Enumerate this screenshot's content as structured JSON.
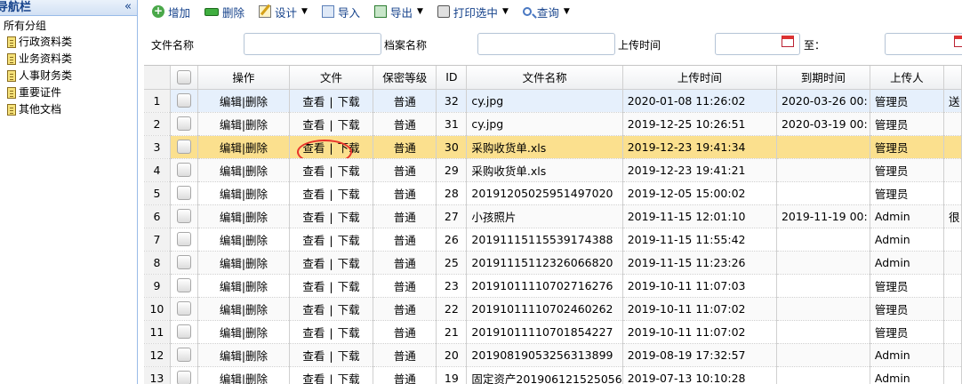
{
  "nav": {
    "title": "导航栏",
    "collapse_glyph": "«",
    "root": "所有分组",
    "items": [
      "行政资料类",
      "业务资料类",
      "人事财务类",
      "重要证件",
      "其他文档"
    ]
  },
  "toolbar": {
    "add": "增加",
    "delete": "删除",
    "design": "设计",
    "import": "导入",
    "export": "导出",
    "print": "打印选中",
    "query": "查询"
  },
  "search": {
    "file_name_label": "文件名称",
    "archive_name_label": "档案名称",
    "upload_time_label": "上传时间",
    "to_label": "至："
  },
  "grid": {
    "headers": {
      "op": "操作",
      "file": "文件",
      "security": "保密等级",
      "id": "ID",
      "name": "文件名称",
      "upload_time": "上传时间",
      "expire_time": "到期时间",
      "uploader": "上传人"
    },
    "op_edit": "编辑",
    "op_sep": "|",
    "op_delete": "删除",
    "file_view": "查看",
    "file_sep": "|",
    "file_download": "下载",
    "rows": [
      {
        "n": "1",
        "security": "普通",
        "id": "32",
        "name": "cy.jpg",
        "upload": "2020-01-08 11:26:02",
        "expire": "2020-03-26 00:",
        "uploader": "管理员",
        "extra": "送"
      },
      {
        "n": "2",
        "security": "普通",
        "id": "31",
        "name": "cy.jpg",
        "upload": "2019-12-25 10:26:51",
        "expire": "2020-03-19 00:",
        "uploader": "管理员",
        "extra": ""
      },
      {
        "n": "3",
        "security": "普通",
        "id": "30",
        "name": "采购收货单.xls",
        "upload": "2019-12-23 19:41:34",
        "expire": "",
        "uploader": "管理员",
        "extra": ""
      },
      {
        "n": "4",
        "security": "普通",
        "id": "29",
        "name": "采购收货单.xls",
        "upload": "2019-12-23 19:41:21",
        "expire": "",
        "uploader": "管理员",
        "extra": ""
      },
      {
        "n": "5",
        "security": "普通",
        "id": "28",
        "name": "20191205025951497020",
        "upload": "2019-12-05 15:00:02",
        "expire": "",
        "uploader": "管理员",
        "extra": ""
      },
      {
        "n": "6",
        "security": "普通",
        "id": "27",
        "name": "小孩照片",
        "upload": "2019-11-15 12:01:10",
        "expire": "2019-11-19 00:",
        "uploader": "Admin",
        "extra": "很"
      },
      {
        "n": "7",
        "security": "普通",
        "id": "26",
        "name": "20191115115539174388",
        "upload": "2019-11-15 11:55:42",
        "expire": "",
        "uploader": "Admin",
        "extra": ""
      },
      {
        "n": "8",
        "security": "普通",
        "id": "25",
        "name": "20191115112326066820",
        "upload": "2019-11-15 11:23:26",
        "expire": "",
        "uploader": "Admin",
        "extra": ""
      },
      {
        "n": "9",
        "security": "普通",
        "id": "23",
        "name": "20191011110702716276",
        "upload": "2019-10-11 11:07:03",
        "expire": "",
        "uploader": "管理员",
        "extra": ""
      },
      {
        "n": "10",
        "security": "普通",
        "id": "22",
        "name": "20191011110702460262",
        "upload": "2019-10-11 11:07:02",
        "expire": "",
        "uploader": "管理员",
        "extra": ""
      },
      {
        "n": "11",
        "security": "普通",
        "id": "21",
        "name": "20191011110701854227",
        "upload": "2019-10-11 11:07:02",
        "expire": "",
        "uploader": "管理员",
        "extra": ""
      },
      {
        "n": "12",
        "security": "普通",
        "id": "20",
        "name": "20190819053256313899",
        "upload": "2019-08-19 17:32:57",
        "expire": "",
        "uploader": "Admin",
        "extra": ""
      },
      {
        "n": "13",
        "security": "普通",
        "id": "19",
        "name": "固定资产201906121525056",
        "upload": "2019-07-13 10:10:28",
        "expire": "",
        "uploader": "Admin",
        "extra": ""
      }
    ]
  },
  "colors": {
    "selected_row": "#fbe08e",
    "hover_row": "#e6f0fc",
    "highlight_circle": "#e8332a",
    "toolbar_text": "#15428b"
  }
}
